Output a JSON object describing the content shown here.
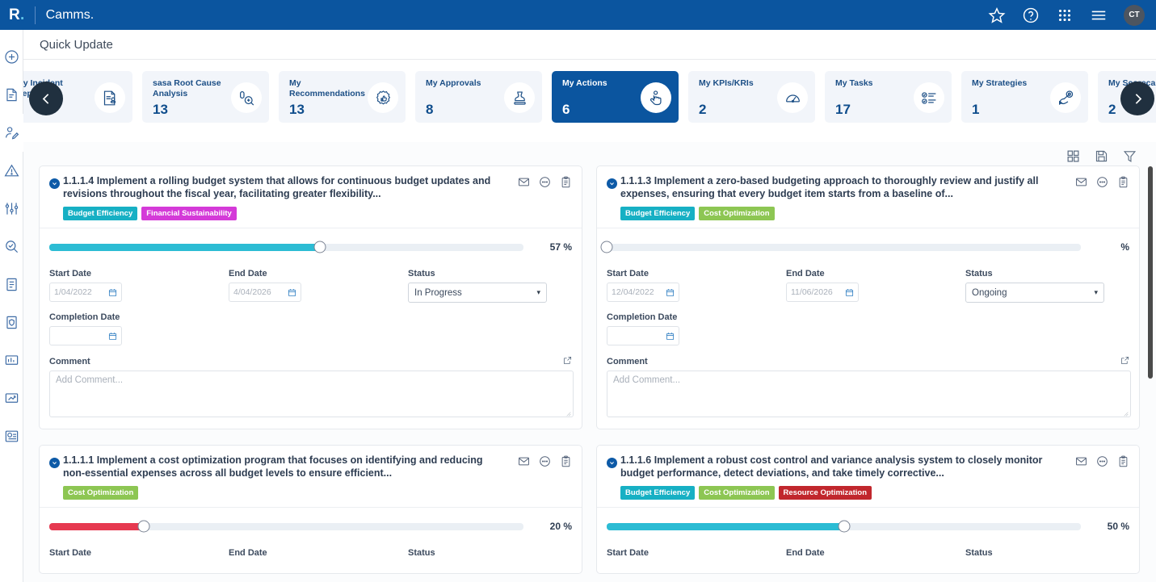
{
  "topbar": {
    "logo": "R",
    "logo_dot": ".",
    "brand": "Camms.",
    "icons": [
      "star-icon",
      "help-icon",
      "apps-grid-icon",
      "hamburger-menu-icon"
    ],
    "avatar_initials": "CT"
  },
  "page": {
    "title": "Quick Update"
  },
  "rail": {
    "items": [
      {
        "name": "add-icon"
      },
      {
        "name": "document-edit-icon"
      },
      {
        "name": "user-edit-icon"
      },
      {
        "name": "risk-warning-icon"
      },
      {
        "name": "controls-sliders-icon"
      },
      {
        "name": "audit-search-icon"
      },
      {
        "name": "register-document-icon"
      },
      {
        "name": "compliance-shield-icon"
      },
      {
        "name": "analytics-report-icon"
      },
      {
        "name": "performance-chart-icon"
      },
      {
        "name": "scorecard-icon"
      }
    ]
  },
  "carousel": {
    "prev_label": "‹",
    "next_label": "›",
    "cards": [
      {
        "label": "My Incident Reports",
        "count": "",
        "icon": "incident-report-icon",
        "active": false
      },
      {
        "label": "sasa Root Cause Analysis",
        "count": "13",
        "icon": "root-cause-icon",
        "active": false
      },
      {
        "label": "My Recommendations",
        "count": "13",
        "icon": "recommendation-badge-icon",
        "active": false
      },
      {
        "label": "My Approvals",
        "count": "8",
        "icon": "approval-stamp-icon",
        "active": false
      },
      {
        "label": "My Actions",
        "count": "6",
        "icon": "action-hand-icon",
        "active": true
      },
      {
        "label": "My KPIs/KRIs",
        "count": "2",
        "icon": "gauge-icon",
        "active": false
      },
      {
        "label": "My Tasks",
        "count": "17",
        "icon": "task-checklist-icon",
        "active": false
      },
      {
        "label": "My Strategies",
        "count": "1",
        "icon": "strategy-target-icon",
        "active": false
      },
      {
        "label": "My Scorecards",
        "count": "2",
        "icon": "scorecard-grid-icon",
        "active": false
      }
    ]
  },
  "toolbar": {
    "icons": [
      {
        "name": "grid-view-icon"
      },
      {
        "name": "save-icon"
      },
      {
        "name": "filter-icon"
      }
    ]
  },
  "labels": {
    "start_date": "Start Date",
    "end_date": "End Date",
    "status": "Status",
    "completion_date": "Completion Date",
    "comment": "Comment",
    "comment_placeholder": "Add Comment...",
    "percent_suffix": "%"
  },
  "badge_colors": {
    "Budget Efficiency": "#17b0c4",
    "Financial Sustainability": "#d43ad8",
    "Cost Optimization": "#8dc653",
    "Resource Optimization": "#c1272d"
  },
  "cards": [
    {
      "title": "1.1.1.4 Implement a rolling budget system that allows for continuous budget updates and revisions throughout the fiscal year, facilitating greater flexibility...",
      "badges": [
        "Budget Efficiency",
        "Financial Sustainability"
      ],
      "progress": 57,
      "progress_text": "57 %",
      "bar_color": "#2cbcd4",
      "start_date": "1/04/2022",
      "end_date": "4/04/2026",
      "status": "In Progress",
      "completion_date": "",
      "comment": ""
    },
    {
      "title": "1.1.1.3 Implement a zero-based budgeting approach to thoroughly review and justify all expenses, ensuring that every budget item starts from a baseline of...",
      "badges": [
        "Budget Efficiency",
        "Cost Optimization"
      ],
      "progress": 0,
      "progress_text": "%",
      "bar_color": "#2cbcd4",
      "start_date": "12/04/2022",
      "end_date": "11/06/2026",
      "status": "Ongoing",
      "completion_date": "",
      "comment": ""
    },
    {
      "title": "1.1.1.1 Implement a cost optimization program that focuses on identifying and reducing non-essential expenses across all budget levels to ensure efficient...",
      "badges": [
        "Cost Optimization"
      ],
      "progress": 20,
      "progress_text": "20 %",
      "bar_color": "#e63950",
      "start_date": "",
      "end_date": "",
      "status": "",
      "completion_date": "",
      "comment": ""
    },
    {
      "title": "1.1.1.6 Implement a robust cost control and variance analysis system to closely monitor budget performance, detect deviations, and take timely corrective...",
      "badges": [
        "Budget Efficiency",
        "Cost Optimization",
        "Resource Optimization"
      ],
      "progress": 50,
      "progress_text": "50 %",
      "bar_color": "#2cbcd4",
      "start_date": "",
      "end_date": "",
      "status": "",
      "completion_date": "",
      "comment": ""
    }
  ]
}
